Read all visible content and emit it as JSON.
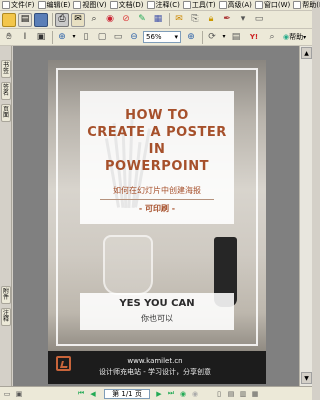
{
  "menubar": {
    "items": [
      {
        "label": "文件(F)"
      },
      {
        "label": "编辑(E)"
      },
      {
        "label": "视图(V)"
      },
      {
        "label": "文档(D)"
      },
      {
        "label": "注释(C)"
      },
      {
        "label": "工具(T)"
      },
      {
        "label": "高级(A)"
      },
      {
        "label": "窗口(W)"
      },
      {
        "label": "帮助(H)"
      }
    ]
  },
  "toolbar2": {
    "zoom_value": "56%",
    "help_label": "帮助"
  },
  "left_panel": {
    "tabs": [
      "书签",
      "签名",
      "页面",
      "附件",
      "注释"
    ]
  },
  "poster": {
    "title_lines": [
      "HOW TO",
      "CREATE A POSTER",
      "IN",
      "POWERPOINT"
    ],
    "subtitle": "如何在幻灯片中创建海报",
    "printable": "- 可印刷 -",
    "yes_title": "YES YOU CAN",
    "yes_sub": "你也可以",
    "footer_url": "www.kamilet.cn",
    "footer_slogan": "设计师充电站 - 学习设计，分享创意"
  },
  "statusbar": {
    "page_indicator": "第 1/1 页"
  },
  "colors": {
    "accent": "#a6502b",
    "footer_bg": "#1c1c1c",
    "chrome": "#ece9d8"
  }
}
